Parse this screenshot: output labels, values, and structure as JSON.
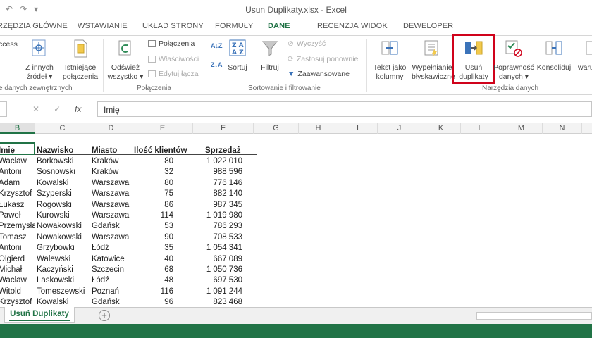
{
  "window": {
    "title": "Usun Duplikaty.xlsx - Excel",
    "qat_undo": "↶",
    "qat_redo": "↷",
    "qat_more": "▾"
  },
  "tabs": [
    {
      "label": "RZĘDZIA GŁÓWNE"
    },
    {
      "label": "WSTAWIANIE"
    },
    {
      "label": "UKŁAD STRONY"
    },
    {
      "label": "FORMUŁY"
    },
    {
      "label": "DANE"
    },
    {
      "label": "RECENZJA"
    },
    {
      "label": "WIDOK"
    },
    {
      "label": "DEWELOPER"
    }
  ],
  "ribbon": {
    "access_label": "ccess",
    "z_innych_line1": "Z innych",
    "z_innych_line2": "źródeł ▾",
    "istniejace_line1": "Istniejące",
    "istniejace_line2": "połączenia",
    "group_external": "e danych zewnętrznych",
    "odswiez_line1": "Odśwież",
    "odswiez_line2": "wszystko ▾",
    "polaczenia_small": "Połączenia",
    "wlasciwosci_small": "Właściwości",
    "edytuj_small": "Edytuj łącza",
    "group_polaczenia": "Połączenia",
    "sortuj_label": "Sortuj",
    "filtruj_label": "Filtruj",
    "wyczysc_small": "Wyczyść",
    "zastosuj_small": "Zastosuj ponownie",
    "zaawansowane_small": "Zaawansowane",
    "group_sort": "Sortowanie i filtrowanie",
    "tekst_line1": "Tekst jako",
    "tekst_line2": "kolumny",
    "wypelnianie_line1": "Wypełnianie",
    "wypelnianie_line2": "błyskawiczne",
    "usun_line1": "Usuń",
    "usun_line2": "duplikaty",
    "poprawnosc_line1": "Poprawność",
    "poprawnosc_line2": "danych ▾",
    "konsoliduj_label": "Konsoliduj",
    "analiza_line2": "warun",
    "group_narzedzia": "Narzędzia danych"
  },
  "formula_bar": {
    "cancel": "✕",
    "enter": "✓",
    "fx": "fx",
    "value": "Imię"
  },
  "column_headers": [
    "B",
    "C",
    "D",
    "E",
    "F",
    "G",
    "H",
    "I",
    "J",
    "K",
    "L",
    "M",
    "N"
  ],
  "table": {
    "headers": [
      "Imię",
      "Nazwisko",
      "Miasto",
      "Ilość klientów",
      "Sprzedaż"
    ],
    "rows": [
      [
        "Wacław",
        "Borkowski",
        "Kraków",
        "80",
        "1 022 010"
      ],
      [
        "Antoni",
        "Sosnowski",
        "Kraków",
        "32",
        "988 596"
      ],
      [
        "Adam",
        "Kowalski",
        "Warszawa",
        "80",
        "776 146"
      ],
      [
        "Krzysztof",
        "Szyperski",
        "Warszawa",
        "75",
        "882 140"
      ],
      [
        "Łukasz",
        "Rogowski",
        "Warszawa",
        "86",
        "987 345"
      ],
      [
        "Paweł",
        "Kurowski",
        "Warszawa",
        "114",
        "1 019 980"
      ],
      [
        "Przemysła",
        "Nowakowski",
        "Gdańsk",
        "53",
        "786 293"
      ],
      [
        "Tomasz",
        "Nowakowski",
        "Warszawa",
        "90",
        "708 533"
      ],
      [
        "Antoni",
        "Grzybowki",
        "Łódź",
        "35",
        "1 054 341"
      ],
      [
        "Olgierd",
        "Walewski",
        "Katowice",
        "40",
        "667 089"
      ],
      [
        "Michał",
        "Kaczyński",
        "Szczecin",
        "68",
        "1 050 736"
      ],
      [
        "Wacław",
        "Laskowski",
        "Łódź",
        "48",
        "697 530"
      ],
      [
        "Witold",
        "Tomeszewski",
        "Poznań",
        "116",
        "1 091 244"
      ],
      [
        "Krzysztof",
        "Kowalski",
        "Gdańsk",
        "96",
        "823 468"
      ]
    ]
  },
  "sheets": {
    "active": "Usuń Duplikaty",
    "add": "+"
  },
  "colors": {
    "accent": "#217346",
    "highlight": "#d0021b"
  }
}
